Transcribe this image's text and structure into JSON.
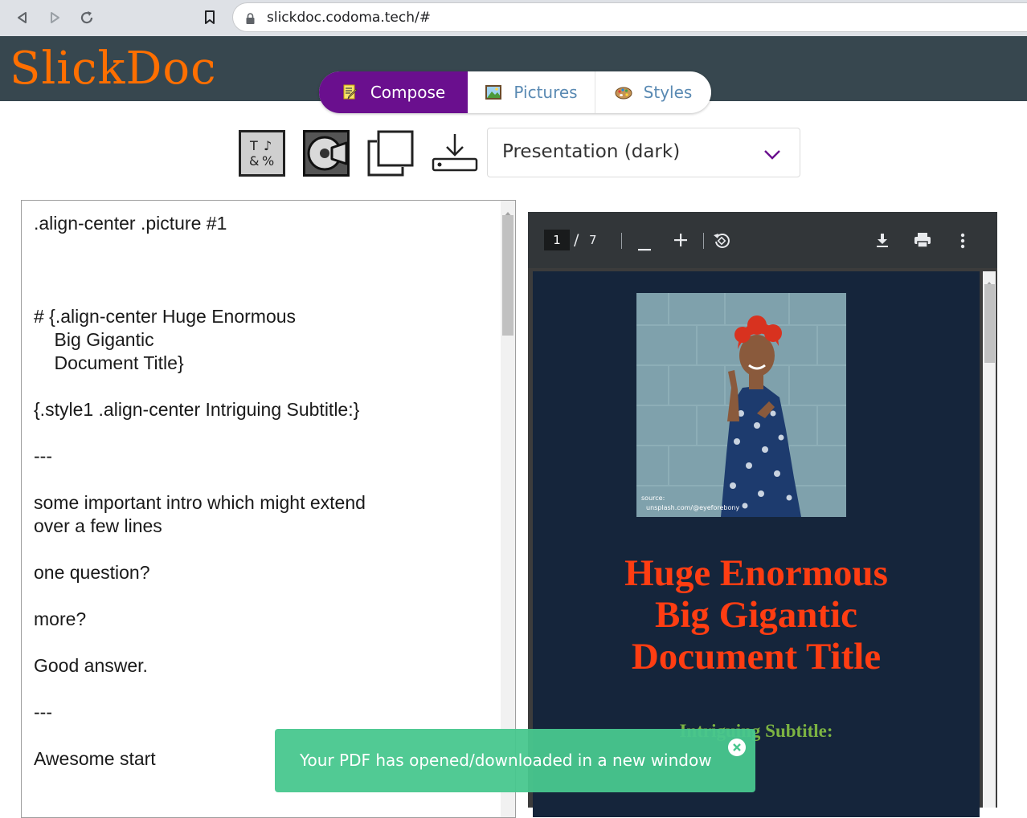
{
  "browser": {
    "url": "slickdoc.codoma.tech/#"
  },
  "app": {
    "logo": "SlickDoc",
    "tabs": [
      {
        "label": "Compose",
        "icon": "memo-pencil-icon",
        "active": true
      },
      {
        "label": "Pictures",
        "icon": "framed-picture-icon",
        "active": false
      },
      {
        "label": "Styles",
        "icon": "artist-palette-icon",
        "active": false
      }
    ],
    "accent_color": "#6a0f8e",
    "logo_color": "#ff6f00",
    "header_color": "#37474f"
  },
  "toolbar": {
    "tools": [
      "text-symbols-icon",
      "disc-icon",
      "copy-icon",
      "download-tray-icon"
    ],
    "style_select": {
      "value": "Presentation (dark)"
    }
  },
  "editor": {
    "content": ".align-center .picture #1\n\n\n\n# {.align-center Huge Enormous\n    Big Gigantic\n    Document Title}\n\n{.style1 .align-center Intriguing Subtitle:}\n\n---\n\nsome important intro which might extend\nover a few lines\n\none question?\n\nmore?\n\nGood answer.\n\n---\n\nAwesome start"
  },
  "pdf_viewer": {
    "current_page": "1",
    "separator": "/",
    "total_pages": "7",
    "page": {
      "title_lines": [
        "Huge Enormous",
        "Big Gigantic",
        "Document Title"
      ],
      "subtitle": "Intriguing Subtitle:",
      "photo_credit_1": "source:",
      "photo_credit_2": "unsplash.com/@eyeforebony",
      "background": "#15253b",
      "title_color": "#ff3d12",
      "subtitle_color": "#7cb342"
    }
  },
  "toast": {
    "message": "Your PDF has opened/downloaded in a new window",
    "color": "#48c78e"
  }
}
